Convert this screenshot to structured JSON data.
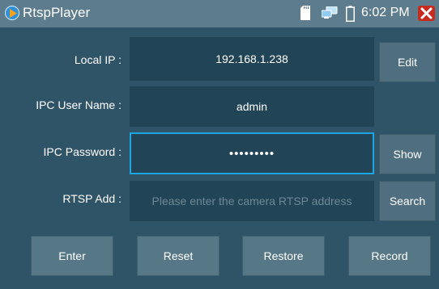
{
  "titlebar": {
    "app_icon": "play-icon",
    "title": "RtspPlayer",
    "status_icons": [
      "sd-card-icon",
      "network-icon",
      "battery-icon"
    ],
    "time": "6:02 PM",
    "close_icon": "close-icon"
  },
  "form": {
    "local_ip": {
      "label": "Local IP :",
      "value": "192.168.1.238",
      "button": "Edit"
    },
    "user_name": {
      "label": "IPC User Name :",
      "value": "admin"
    },
    "password": {
      "label": "IPC Password :",
      "value": "•••••••••",
      "button": "Show"
    },
    "rtsp": {
      "label": "RTSP Add :",
      "placeholder": "Please enter the camera RTSP address",
      "button": "Search"
    }
  },
  "actions": {
    "enter": "Enter",
    "reset": "Reset",
    "restore": "Restore",
    "record": "Record"
  },
  "colors": {
    "background": "#2f5367",
    "titlebar": "#5d7c8d",
    "field": "#214556",
    "focus_border": "#1ba6e3",
    "button": "#567785",
    "close": "#c72a1f"
  }
}
